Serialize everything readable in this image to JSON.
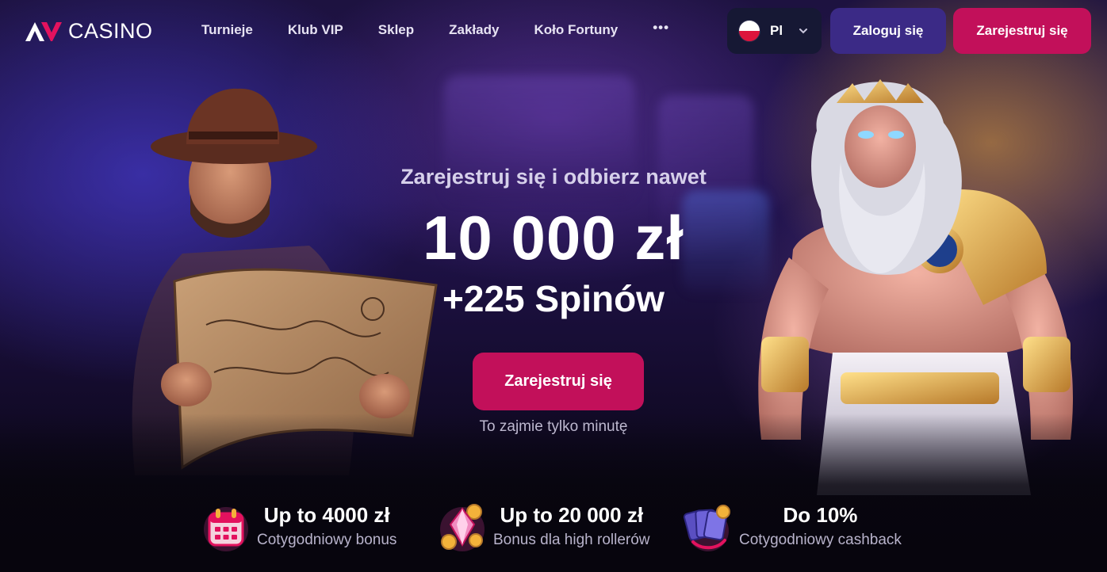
{
  "header": {
    "logo_text": "CASINO",
    "nav": [
      "Turnieje",
      "Klub VIP",
      "Sklep",
      "Zakłady",
      "Koło Fortuny"
    ],
    "more": "•••",
    "language": "Pl",
    "login_label": "Zaloguj się",
    "register_label": "Zarejestruj się"
  },
  "hero": {
    "subtitle": "Zarejestruj się i odbierz nawet",
    "amount": "10 000 zł",
    "spins": "+225 Spinów",
    "cta_label": "Zarejestruj się",
    "note": "To zajmie tylko minutę"
  },
  "benefits": [
    {
      "title": "Up to 4000 zł",
      "desc": "Cotygodniowy bonus",
      "icon": "calendar-icon"
    },
    {
      "title": "Up to 20 000 zł",
      "desc": "Bonus dla high rollerów",
      "icon": "crystal-coins-icon"
    },
    {
      "title": "Do 10%",
      "desc": "Cotygodniowy cashback",
      "icon": "cards-cashback-icon"
    }
  ],
  "colors": {
    "primary": "#c2105a",
    "secondary": "#3b2a86",
    "lang_bg": "#161834",
    "background": "#0b0716"
  }
}
